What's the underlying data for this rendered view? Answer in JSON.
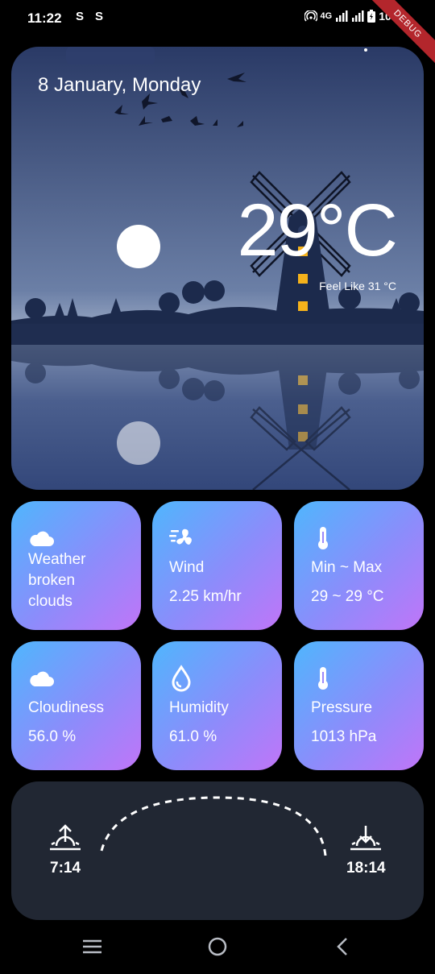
{
  "status_bar": {
    "time": "11:22",
    "notif_icons": [
      "S",
      "S"
    ],
    "network": "4G",
    "battery": "100%",
    "debug_banner": "DEBUG"
  },
  "hero": {
    "date": "8 January, Monday",
    "temperature": "29°C",
    "feels_like": "Feel Like 31 °C"
  },
  "cards": [
    {
      "title": "Weather\nbroken\nclouds",
      "value": "",
      "icon": "cloud-icon"
    },
    {
      "title": "Wind",
      "value": "2.25 km/hr",
      "icon": "wind-icon"
    },
    {
      "title": "Min ~ Max",
      "value": "29 ~ 29 °C",
      "icon": "thermometer-icon"
    },
    {
      "title": "Cloudiness",
      "value": "56.0 %",
      "icon": "cloud-icon"
    },
    {
      "title": "Humidity",
      "value": "61.0 %",
      "icon": "droplet-icon"
    },
    {
      "title": "Pressure",
      "value": "1013 hPa",
      "icon": "thermometer-icon"
    }
  ],
  "sun": {
    "sunrise": "7:14",
    "sunset": "18:14"
  },
  "colors": {
    "card_gradient_start": "#4fb6fd",
    "card_gradient_end": "#c075f8",
    "sun_panel_bg": "#212733",
    "window_light": "#f5b21b"
  }
}
